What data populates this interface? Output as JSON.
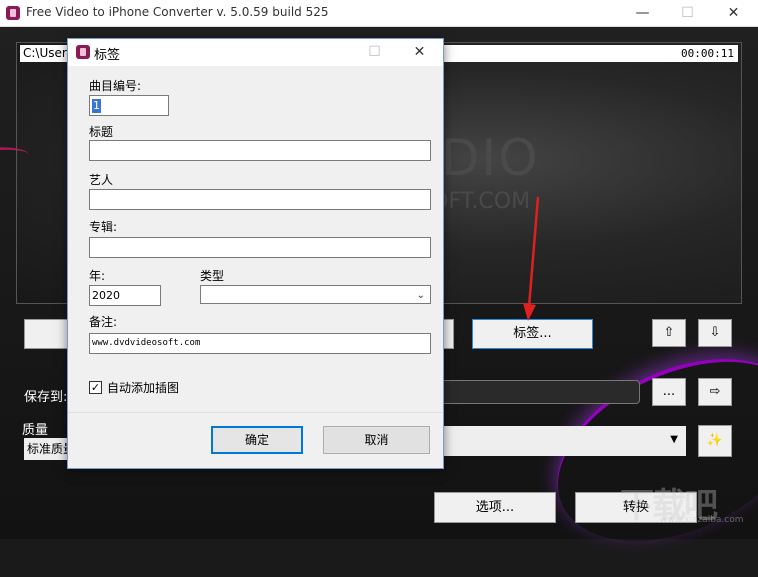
{
  "app": {
    "title": "Free Video to iPhone Converter  v. 5.0.59 build 525",
    "minimize": "—",
    "maximize": "☐",
    "close": "✕"
  },
  "player": {
    "path": "C:\\Users",
    "time": "00:00:11",
    "logo_line1": "DIO",
    "logo_line2": "OFT.COM"
  },
  "buttons": {
    "tags": "标签...",
    "move_up": "⇧",
    "move_down": "⇩",
    "browse": "...",
    "open_folder": "⇨",
    "wand": "✨",
    "options": "选项...",
    "convert": "转换"
  },
  "save": {
    "label": "保存到:"
  },
  "quality": {
    "label": "质量",
    "value": "标准质量"
  },
  "dialog": {
    "title": "标签",
    "maximize": "☐",
    "close": "✕",
    "track_label": "曲目编号:",
    "track_value": "1",
    "title_label": "标题",
    "title_value": "",
    "artist_label": "艺人",
    "artist_value": "",
    "album_label": "专辑:",
    "album_value": "",
    "year_label": "年:",
    "year_value": "2020",
    "genre_label": "类型",
    "genre_value": "",
    "comment_label": "备注:",
    "comment_value": "www.dvdvideosoft.com",
    "auto_cover_label": "自动添加插图",
    "auto_cover_checked": true,
    "ok": "确定",
    "cancel": "取消"
  },
  "watermark": {
    "text": "下载吧",
    "url": "www.xiazaiba.com"
  },
  "colors": {
    "accent_pink": "#d01a6a",
    "accent_purple": "#a000d0",
    "focus_blue": "#0078d7",
    "arrow_red": "#e02020"
  }
}
